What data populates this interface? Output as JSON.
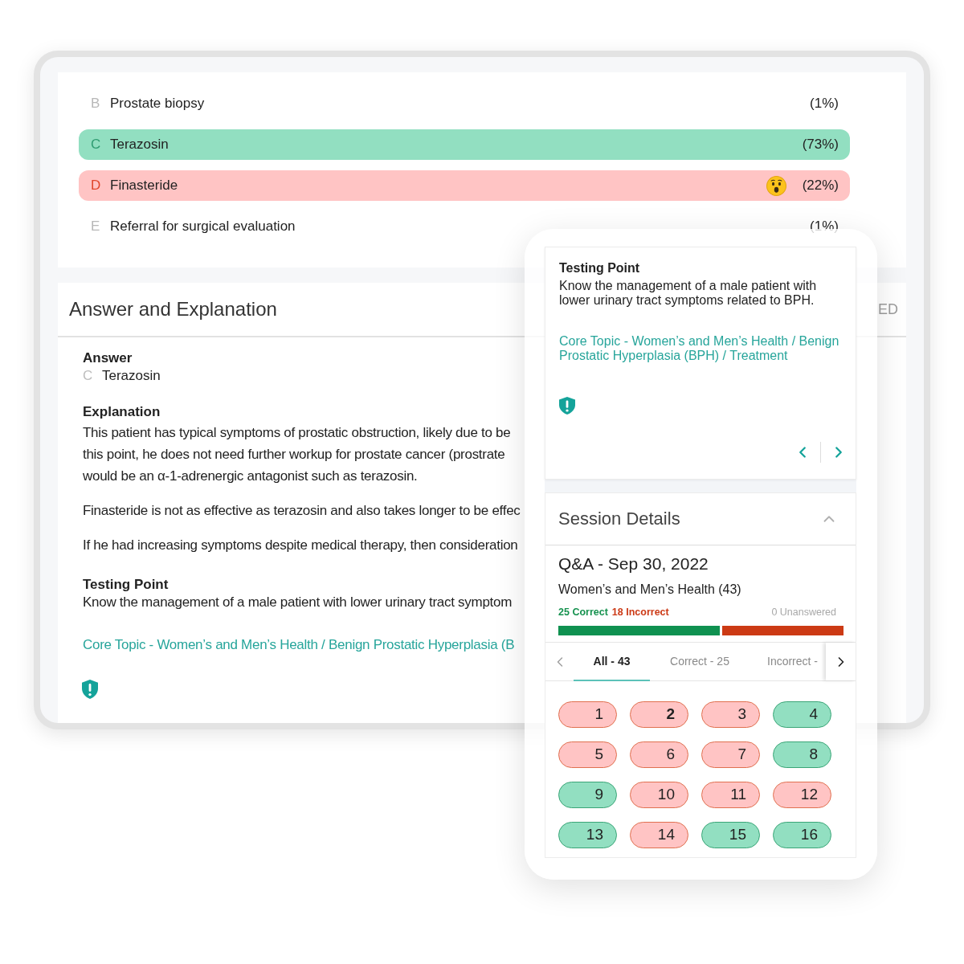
{
  "question_options": [
    {
      "letter": "B",
      "label": "Prostate biopsy",
      "percent": "(1%)",
      "correct": false,
      "your_answer": false
    },
    {
      "letter": "C",
      "label": "Terazosin",
      "percent": "(73%)",
      "correct": true,
      "your_answer": false
    },
    {
      "letter": "D",
      "label": "Finasteride",
      "percent": "(22%)",
      "correct": false,
      "your_answer": true
    },
    {
      "letter": "E",
      "label": "Referral for surgical evaluation",
      "percent": "(1%)",
      "correct": false,
      "your_answer": false
    }
  ],
  "answer_explanation": {
    "title": "Answer and Explanation",
    "header_fragment": "ED",
    "answer_heading": "Answer",
    "answer": {
      "letter": "C",
      "label": "Terazosin"
    },
    "explanation_heading": "Explanation",
    "paragraphs": [
      {
        "lines": [
          "This patient has typical symptoms of prostatic obstruction, likely due to be",
          "this point, he does not need further workup for prostate cancer (prostrate",
          "would be an α-1-adrenergic antagonist such as terazosin."
        ]
      },
      {
        "lines": [
          "Finasteride is not as effective as terazosin and also takes longer to be effec"
        ]
      },
      {
        "lines": [
          "If he had increasing symptoms despite medical therapy, then consideration"
        ]
      }
    ],
    "testing_point": {
      "heading": "Testing Point",
      "text": "Know the management of a male patient with lower urinary tract symptom"
    },
    "topic_link": "Core Topic - Women’s and Men’s Health / Benign Prostatic Hyperplasia (B"
  },
  "phone": {
    "testing_point_card": {
      "heading": "Testing Point",
      "text": "Know the management of a male patient with lower urinary tract symptoms related to BPH.",
      "topic_link": "Core Topic - Women’s and Men’s Health / Benign Prostatic Hyperplasia (BPH) / Treatment"
    },
    "session_details": {
      "title": "Session Details",
      "expanded": true,
      "session_title": "Q&A - Sep 30, 2022",
      "subject": "Women’s and Men’s Health (43)",
      "correct_count": "25 Correct",
      "incorrect_count": "18 Incorrect",
      "unanswered_count": "0 Unanswered",
      "score_bar": {
        "level": 0.575
      },
      "tabs": [
        {
          "label": "All - 43",
          "selected": true
        },
        {
          "label": "Correct - 25",
          "selected": false
        },
        {
          "label": "Incorrect -",
          "selected": false
        }
      ],
      "questions": [
        {
          "number": "1",
          "correct": false,
          "selected": false
        },
        {
          "number": "2",
          "correct": false,
          "selected": true
        },
        {
          "number": "3",
          "correct": false,
          "selected": false
        },
        {
          "number": "4",
          "correct": true,
          "selected": false
        },
        {
          "number": "5",
          "correct": false,
          "selected": false
        },
        {
          "number": "6",
          "correct": false,
          "selected": false
        },
        {
          "number": "7",
          "correct": false,
          "selected": false
        },
        {
          "number": "8",
          "correct": true,
          "selected": false
        },
        {
          "number": "9",
          "correct": true,
          "selected": false
        },
        {
          "number": "10",
          "correct": false,
          "selected": false
        },
        {
          "number": "11",
          "correct": false,
          "selected": false
        },
        {
          "number": "12",
          "correct": false,
          "selected": false
        },
        {
          "number": "13",
          "correct": true,
          "selected": false
        },
        {
          "number": "14",
          "correct": false,
          "selected": false
        },
        {
          "number": "15",
          "correct": true,
          "selected": false
        },
        {
          "number": "16",
          "correct": true,
          "selected": false
        }
      ]
    }
  }
}
